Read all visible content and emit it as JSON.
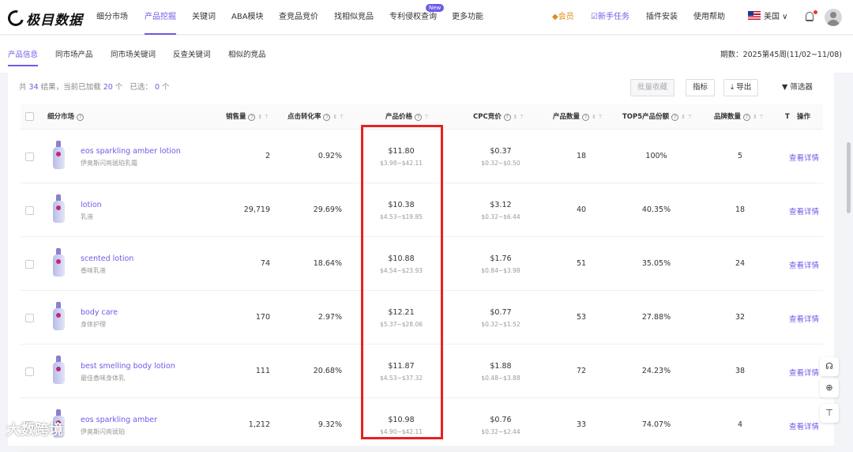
{
  "brand": {
    "name": "极目数据"
  },
  "nav": [
    "细分市场",
    "产品挖掘",
    "关键词",
    "ABA模块",
    "查竞品竞价",
    "找相似竞品",
    "专利侵权查询",
    "更多功能"
  ],
  "nav_new_badge": "New",
  "header_right": {
    "vip": "◆会员",
    "task": "☑新手任务",
    "plugin": "插件安装",
    "help": "使用帮助",
    "region": "美国 ∨"
  },
  "subnav": [
    "产品信息",
    "同市场产品",
    "同市场关键词",
    "反查关键词",
    "相似的竞品"
  ],
  "period": "期数：2025第45周(11/02~11/08)",
  "summary": {
    "prefix": "共",
    "total": "34",
    "mid": "结果，当前已加载",
    "loaded": "20",
    "unit": "个",
    "selected_label": "已选：",
    "selected": "0",
    "selected_unit": "个"
  },
  "toolbar": {
    "batch": "批量收藏",
    "metrics": "指标",
    "export": "导出",
    "filter": "筛选器"
  },
  "columns": {
    "market": "细分市场",
    "sales": "销售量",
    "ctr": "点击转化率",
    "price": "产品价格",
    "cpc": "CPC竞价",
    "count": "产品数量",
    "top5": "TOP5产品份额",
    "brands": "品牌数量",
    "extra": "T",
    "action": "操作"
  },
  "rows": [
    {
      "kw": "eos sparkling amber lotion",
      "kw_cn": "伊奥斯闪亮琥珀乳霜",
      "sales": "2",
      "ctr": "0.92%",
      "price": "$11.80",
      "price_range": "$3.98~$42.11",
      "cpc": "$0.37",
      "cpc_range": "$0.32~$0.50",
      "count": "18",
      "top5": "100%",
      "brands": "5",
      "action": "查看详情"
    },
    {
      "kw": "lotion",
      "kw_cn": "乳液",
      "sales": "29,719",
      "ctr": "29.69%",
      "price": "$10.38",
      "price_range": "$4.53~$19.85",
      "cpc": "$3.12",
      "cpc_range": "$0.32~$6.44",
      "count": "40",
      "top5": "40.35%",
      "brands": "18",
      "action": "查看详情"
    },
    {
      "kw": "scented lotion",
      "kw_cn": "香味乳液",
      "sales": "74",
      "ctr": "18.64%",
      "price": "$10.88",
      "price_range": "$4.54~$23.93",
      "cpc": "$1.76",
      "cpc_range": "$0.84~$3.98",
      "count": "51",
      "top5": "35.05%",
      "brands": "24",
      "action": "查看详情"
    },
    {
      "kw": "body care",
      "kw_cn": "身体护理",
      "sales": "170",
      "ctr": "2.97%",
      "price": "$12.21",
      "price_range": "$5.37~$28.06",
      "cpc": "$0.77",
      "cpc_range": "$0.32~$1.52",
      "count": "53",
      "top5": "27.88%",
      "brands": "32",
      "action": "查看详情"
    },
    {
      "kw": "best smelling body lotion",
      "kw_cn": "最佳香味身体乳",
      "sales": "111",
      "ctr": "20.68%",
      "price": "$11.87",
      "price_range": "$4.53~$37.32",
      "cpc": "$1.88",
      "cpc_range": "$0.48~$3.88",
      "count": "72",
      "top5": "24.23%",
      "brands": "38",
      "action": "查看详情"
    },
    {
      "kw": "eos sparkling amber",
      "kw_cn": "伊奥斯闪亮琥珀",
      "sales": "1,212",
      "ctr": "9.32%",
      "price": "$10.98",
      "price_range": "$4.90~$42.11",
      "cpc": "$0.76",
      "cpc_range": "$0.32~$2.44",
      "count": "33",
      "top5": "74.07%",
      "brands": "4",
      "action": "查看详情"
    }
  ],
  "watermark": "大数跨境"
}
